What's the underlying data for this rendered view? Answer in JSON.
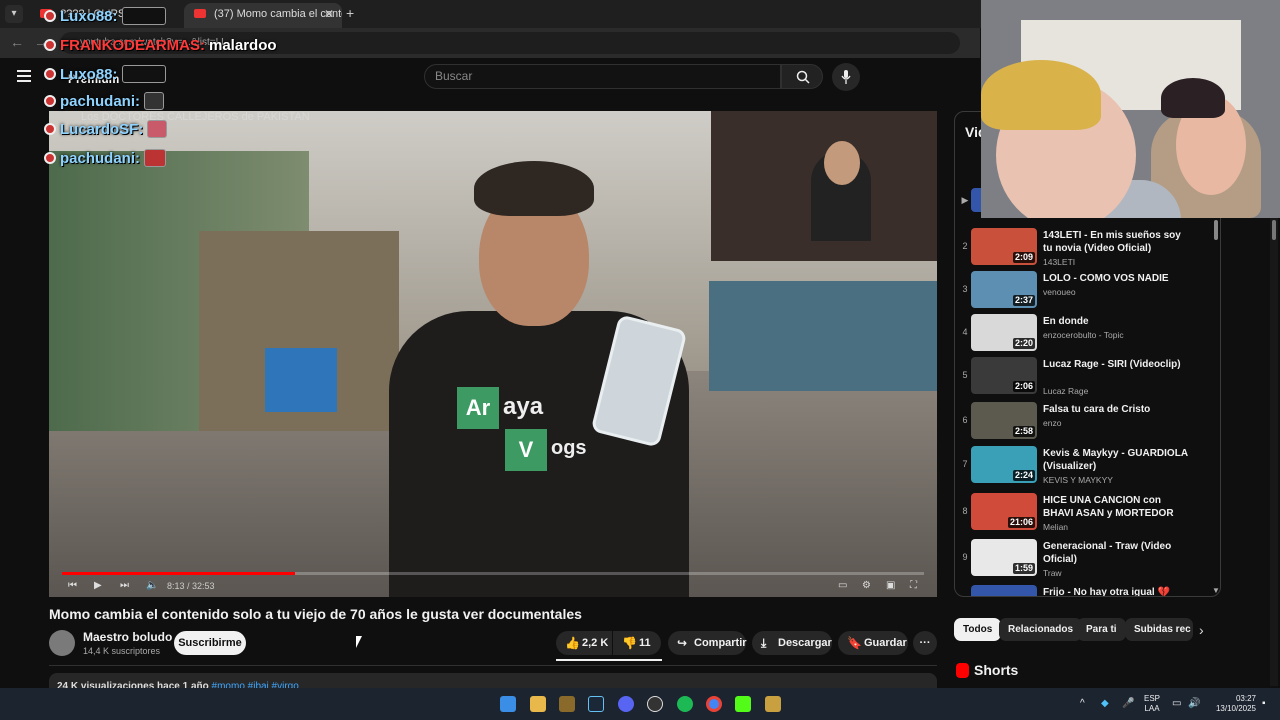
{
  "browser": {
    "tabs": [
      {
        "label": "???? | CLIPS | ...",
        "active": false
      },
      {
        "label": "(37) Momo cambia el conte",
        "active": true
      }
    ],
    "url_text": "youtube.com/watch?v=...&list=LL"
  },
  "chat": [
    {
      "user": "Luxo88:",
      "color": "blue",
      "emote": "emote"
    },
    {
      "user": "FRANKODEARMAS:",
      "color": "red",
      "message": "malardoo"
    },
    {
      "user": "Luxo88:",
      "color": "blue",
      "emote": "emote"
    },
    {
      "user": "pachudani:",
      "color": "blue",
      "emote": "emote"
    },
    {
      "user": "LucardoSF:",
      "color": "blue",
      "emote": "emote"
    },
    {
      "user": "pachudani:",
      "color": "blue",
      "emote": "emote"
    }
  ],
  "header": {
    "premium_label": "Premium",
    "search_placeholder": "Buscar"
  },
  "player": {
    "overlay_title": "Los DOCTORES CALLEJEROS de PAKISTAN",
    "shirt_text_1": "Ar",
    "shirt_text_2": "aya",
    "shirt_text_3": "V",
    "shirt_text_4": "ogs",
    "time_display": "8:13 / 32:53",
    "progress": 0.27
  },
  "video": {
    "title": "Momo cambia el contenido solo a tu viejo de 70 años le gusta ver documentales",
    "channel": "Maestro boludo",
    "subscribers": "14,4 K suscriptores",
    "subscribe_label": "Suscribirme",
    "likes": "2,2 K",
    "dislikes": "11",
    "share_label": "Compartir",
    "download_label": "Descargar",
    "save_label": "Guardar",
    "more_label": "···",
    "description_summary": "24 K visualizaciones  hace 1 año",
    "description_tags": "#momo #ibai #virgo"
  },
  "playlist": {
    "heading": "Vid",
    "items": [
      {
        "num": "2",
        "title": "143LETI - En mis sueños soy tu novia (Video Oficial)",
        "channel": "143LETI",
        "duration": "2:09",
        "thumb": "#c9503a"
      },
      {
        "num": "3",
        "title": "LOLO - COMO VOS NADIE",
        "channel": "venoueo",
        "duration": "2:37",
        "thumb": "#5d8fb3"
      },
      {
        "num": "4",
        "title": "En donde",
        "channel": "enzocerobulto - Topic",
        "duration": "2:20",
        "thumb": "#d9d9d9"
      },
      {
        "num": "5",
        "title": "Lucaz Rage - SIRI (Videoclip)",
        "channel": "Lucaz Rage",
        "duration": "2:06",
        "thumb": "#3a3a3a"
      },
      {
        "num": "6",
        "title": "Falsa tu cara de Cristo",
        "channel": "enzo",
        "duration": "2:58",
        "thumb": "#5c5a4f"
      },
      {
        "num": "7",
        "title": "Kevis & Maykyy - GUARDIOLA (Visualizer)",
        "channel": "KEVIS Y MAYKYY",
        "duration": "2:24",
        "thumb": "#3aa0b8"
      },
      {
        "num": "8",
        "title": "HICE UNA CANCION con BHAVI ASAN y MORTEDOR",
        "channel": "Melian",
        "duration": "21:06",
        "thumb": "#d04b3a"
      },
      {
        "num": "9",
        "title": "Generacional - Traw (Video Oficial)",
        "channel": "Traw",
        "duration": "1:59",
        "thumb": "#e8e8e8"
      },
      {
        "num": "10",
        "title": "Frijo - No hay otra igual 💔",
        "channel": "",
        "duration": "",
        "thumb": "#3355aa"
      }
    ]
  },
  "chips": [
    "Todos",
    "Relacionados",
    "Para ti",
    "Subidas rec"
  ],
  "shorts_label": "Shorts",
  "taskbar": {
    "lang_1": "ESP",
    "lang_2": "LAA",
    "time": "03:27",
    "date": "13/10/2025"
  }
}
